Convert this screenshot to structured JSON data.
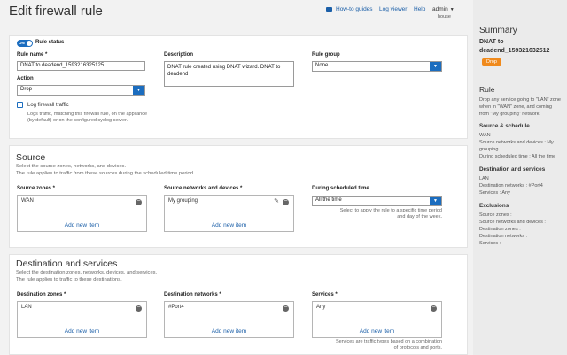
{
  "page": {
    "title": "Edit firewall rule"
  },
  "topnav": {
    "howto": "How-to guides",
    "logviewer": "Log viewer",
    "help": "Help",
    "user": "admin",
    "house": "house"
  },
  "rule": {
    "status_toggle": "ON",
    "status_label": "Rule status",
    "name_label": "Rule name *",
    "name_value": "DNAT to deadend_1593216325125",
    "action_label": "Action",
    "action_value": "Drop",
    "description_label": "Description",
    "description_value": "DNAT rule created using DNAT wizard. DNAT to deadend",
    "group_label": "Rule group",
    "group_value": "None",
    "log_label": "Log firewall traffic",
    "log_hint_1": "Logs traffic, matching this firewall rule, on the appliance",
    "log_hint_2": "(by default) or on the configured syslog server."
  },
  "source": {
    "title": "Source",
    "desc_1": "Select the source zones, networks, and devices.",
    "desc_2": "The rule applies to traffic from these sources during the scheduled time period.",
    "zones_label": "Source zones *",
    "zones_item": "WAN",
    "networks_label": "Source networks and devices *",
    "networks_item": "My grouping",
    "schedule_label": "During scheduled time",
    "schedule_value": "All the time",
    "schedule_hint_1": "Select to apply the rule to a specific time period",
    "schedule_hint_2": "and day of the week.",
    "add_new": "Add new item"
  },
  "destination": {
    "title": "Destination and services",
    "desc_1": "Select the destination zones, networks, devices, and services.",
    "desc_2": "The rule applies to traffic to these destinations.",
    "zones_label": "Destination zones *",
    "zones_item": "LAN",
    "networks_label": "Destination networks *",
    "networks_item": "#Port4",
    "services_label": "Services *",
    "services_item": "Any",
    "services_hint_1": "Services are traffic types based on a combination",
    "services_hint_2": "of protocols and ports.",
    "add_new": "Add new item"
  },
  "summary": {
    "title": "Summary",
    "rule_name_1": "DNAT to",
    "rule_name_2": "deadend_159321632512",
    "action_badge": "Drop",
    "rule_heading": "Rule",
    "rule_text_1": "Drop any service going to \"LAN\" zone",
    "rule_text_2": "when in \"WAN\" zone, and coming",
    "rule_text_3": "from \"My grouping\" network",
    "src_heading": "Source & schedule",
    "src_1": "WAN",
    "src_2": "Source networks and devices : My",
    "src_3": "grouping",
    "src_4": "During scheduled time : All the time",
    "dst_heading": "Destination and services",
    "dst_1": "LAN",
    "dst_2": "Destination networks : #Port4",
    "dst_3": "Services : Any",
    "exc_heading": "Exclusions",
    "exc_1": "Source zones :",
    "exc_2": "Source networks and devices :",
    "exc_3": "Destination zones :",
    "exc_4": "Destination networks :",
    "exc_5": "Services :"
  },
  "colors": {
    "accent": "#1b6dbf",
    "link": "#1b5fa8",
    "drop_badge": "#f08a1c"
  }
}
